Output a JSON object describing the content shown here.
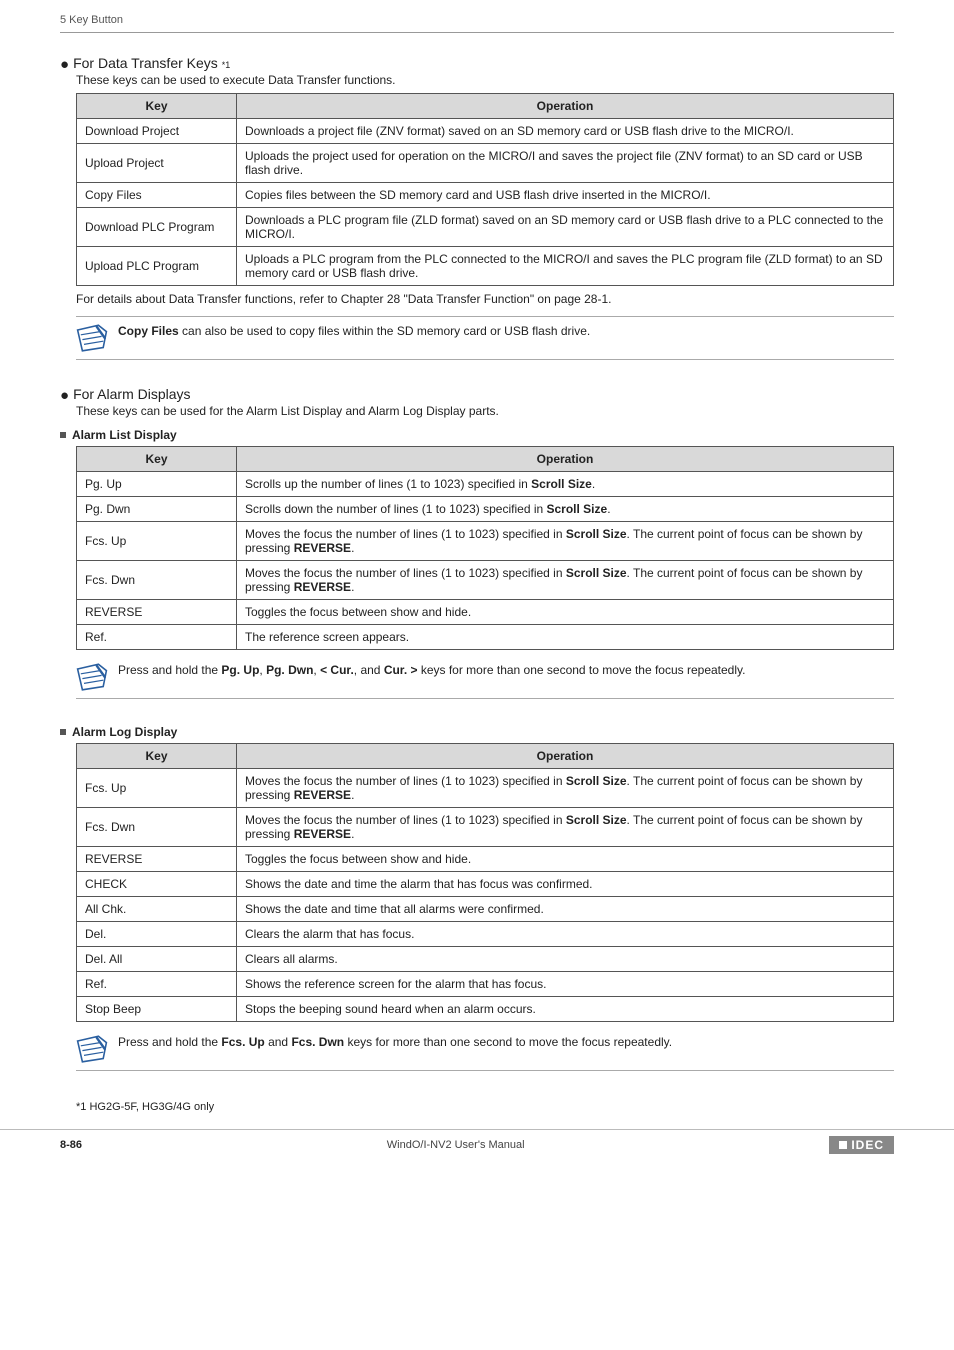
{
  "header": {
    "chapter": "5 Key Button"
  },
  "section1": {
    "title": "For Data Transfer Keys",
    "sup": "*1",
    "desc": "These keys can be used to execute Data Transfer functions.",
    "table": {
      "head_key": "Key",
      "head_op": "Operation",
      "rows": [
        {
          "k": "Download Project",
          "op": "Downloads a project file (ZNV format) saved on an SD memory card or USB flash drive to the MICRO/I."
        },
        {
          "k": "Upload Project",
          "op": "Uploads the project used for operation on the MICRO/I and saves the project file (ZNV format) to an SD card or USB flash drive."
        },
        {
          "k": "Copy Files",
          "op": "Copies files between the SD memory card and USB flash drive inserted in the MICRO/I."
        },
        {
          "k": "Download PLC Program",
          "op": "Downloads a PLC program file (ZLD format) saved on an SD memory card or USB flash drive to a PLC connected to the MICRO/I."
        },
        {
          "k": "Upload PLC Program",
          "op": "Uploads a PLC program from the PLC connected to the MICRO/I and saves the PLC program file (ZLD format) to an SD memory card or USB flash drive."
        }
      ]
    },
    "after": "For details about Data Transfer functions, refer to Chapter 28 \"Data Transfer Function\" on page 28-1.",
    "note_prefix": "Copy Files",
    "note_rest": " can also be used to copy files within the SD memory card or USB flash drive."
  },
  "section2": {
    "title": "For Alarm Displays",
    "desc": "These keys can be used for the Alarm List Display and Alarm Log Display parts.",
    "sub1": "Alarm List Display",
    "table1": {
      "head_key": "Key",
      "head_op": "Operation",
      "rows": [
        {
          "k": "Pg. Up",
          "op_pre": "Scrolls up the number of lines (1 to 1023) specified in ",
          "b": "Scroll Size",
          "op_post": "."
        },
        {
          "k": "Pg. Dwn",
          "op_pre": "Scrolls down the number of lines (1 to 1023) specified in ",
          "b": "Scroll Size",
          "op_post": "."
        },
        {
          "k": "Fcs. Up",
          "op_pre": "Moves the focus the number of lines (1 to 1023) specified in ",
          "b": "Scroll Size",
          "mid": ". The current point of focus can be shown by pressing ",
          "b2": "REVERSE",
          "post2": "."
        },
        {
          "k": "Fcs. Dwn",
          "op_pre": "Moves the focus the number of lines (1 to 1023) specified in ",
          "b": "Scroll Size",
          "mid": ". The current point of focus can be shown by pressing ",
          "b2": "REVERSE",
          "post2": "."
        },
        {
          "k": "REVERSE",
          "plain": "Toggles the focus between show and hide."
        },
        {
          "k": "Ref.",
          "plain": "The reference screen appears."
        }
      ]
    },
    "note1_pre": "Press and hold the ",
    "note1_keys": "Pg. Up, Pg. Dwn, < Cur., and Cur. >",
    "note1_k1": "Pg. Up",
    "note1_k2": "Pg. Dwn",
    "note1_k3": "< Cur.",
    "note1_k4": "Cur. >",
    "note1_post": " keys for more than one second to move the focus repeatedly.",
    "sub2": "Alarm Log Display",
    "table2": {
      "head_key": "Key",
      "head_op": "Operation",
      "rows": [
        {
          "k": "Fcs. Up",
          "op_pre": "Moves the focus the number of lines (1 to 1023) specified in ",
          "b": "Scroll Size",
          "mid": ". The current point of focus can be shown by pressing ",
          "b2": "REVERSE",
          "post2": "."
        },
        {
          "k": "Fcs. Dwn",
          "op_pre": "Moves the focus the number of lines (1 to 1023) specified in ",
          "b": "Scroll Size",
          "mid": ". The current point of focus can be shown by pressing ",
          "b2": "REVERSE",
          "post2": "."
        },
        {
          "k": "REVERSE",
          "plain": "Toggles the focus between show and hide."
        },
        {
          "k": "CHECK",
          "plain": "Shows the date and time the alarm that has focus was confirmed."
        },
        {
          "k": "All Chk.",
          "plain": "Shows the date and time that all alarms were confirmed."
        },
        {
          "k": "Del.",
          "plain": "Clears the alarm that has focus."
        },
        {
          "k": "Del. All",
          "plain": "Clears all alarms."
        },
        {
          "k": "Ref.",
          "plain": "Shows the reference screen for the alarm that has focus."
        },
        {
          "k": "Stop Beep",
          "plain": "Stops the beeping sound heard when an alarm occurs."
        }
      ]
    },
    "note2_pre": "Press and hold the ",
    "note2_k1": "Fcs. Up",
    "note2_and": " and ",
    "note2_k2": "Fcs. Dwn",
    "note2_post": " keys for more than one second to move the focus repeatedly."
  },
  "footnote": "*1 HG2G-5F, HG3G/4G only",
  "footer": {
    "page": "8-86",
    "center": "WindO/I-NV2 User's Manual",
    "brand": "IDEC"
  }
}
